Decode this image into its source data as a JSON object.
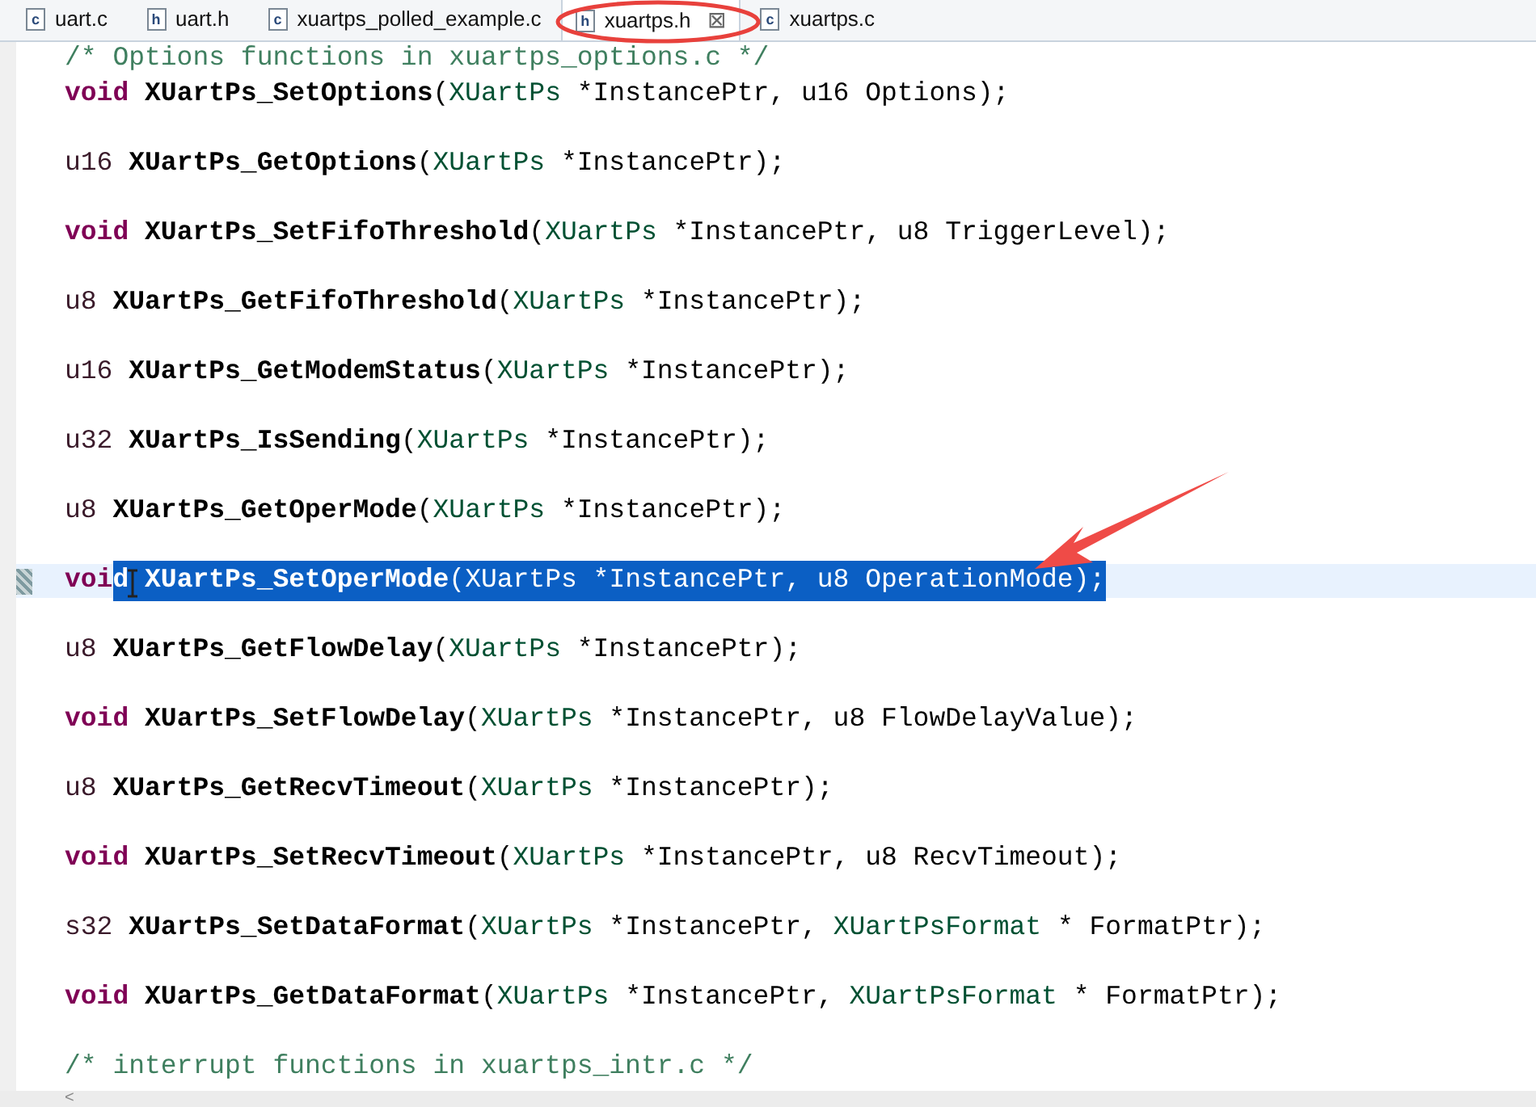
{
  "tabs": [
    {
      "icon": "c",
      "label": "uart.c",
      "selected": false,
      "closable": false
    },
    {
      "icon": "h",
      "label": "uart.h",
      "selected": false,
      "closable": false
    },
    {
      "icon": "c",
      "label": "xuartps_polled_example.c",
      "selected": false,
      "closable": false
    },
    {
      "icon": "h",
      "label": "xuartps.h",
      "selected": true,
      "closable": true
    },
    {
      "icon": "c",
      "label": "xuartps.c",
      "selected": false,
      "closable": false
    }
  ],
  "close_glyph": "⊠",
  "lines": [
    {
      "kind": "comment",
      "text": "/* Options functions in xuartps_options.c */"
    },
    {
      "kind": "code",
      "current": false,
      "tokens": [
        {
          "kind": "keyword",
          "text": "void"
        },
        {
          "kind": "func",
          "text": "XUartPs_SetOptions"
        },
        {
          "kind": "plain",
          "text": "("
        },
        {
          "kind": "typedef",
          "text": "XUartPs"
        },
        {
          "kind": "plain",
          "text": " *InstancePtr, u16 Options);"
        }
      ]
    },
    {
      "kind": "blank"
    },
    {
      "kind": "code",
      "current": false,
      "tokens": [
        {
          "kind": "type",
          "text": "u16"
        },
        {
          "kind": "func",
          "text": "XUartPs_GetOptions"
        },
        {
          "kind": "plain",
          "text": "("
        },
        {
          "kind": "typedef",
          "text": "XUartPs"
        },
        {
          "kind": "plain",
          "text": " *InstancePtr);"
        }
      ]
    },
    {
      "kind": "blank"
    },
    {
      "kind": "code",
      "current": false,
      "tokens": [
        {
          "kind": "keyword",
          "text": "void"
        },
        {
          "kind": "func",
          "text": "XUartPs_SetFifoThreshold"
        },
        {
          "kind": "plain",
          "text": "("
        },
        {
          "kind": "typedef",
          "text": "XUartPs"
        },
        {
          "kind": "plain",
          "text": " *InstancePtr, u8 TriggerLevel);"
        }
      ]
    },
    {
      "kind": "blank"
    },
    {
      "kind": "code",
      "current": false,
      "tokens": [
        {
          "kind": "type",
          "text": "u8"
        },
        {
          "kind": "func",
          "text": "XUartPs_GetFifoThreshold"
        },
        {
          "kind": "plain",
          "text": "("
        },
        {
          "kind": "typedef",
          "text": "XUartPs"
        },
        {
          "kind": "plain",
          "text": " *InstancePtr);"
        }
      ]
    },
    {
      "kind": "blank"
    },
    {
      "kind": "code",
      "current": false,
      "tokens": [
        {
          "kind": "type",
          "text": "u16"
        },
        {
          "kind": "func",
          "text": "XUartPs_GetModemStatus"
        },
        {
          "kind": "plain",
          "text": "("
        },
        {
          "kind": "typedef",
          "text": "XUartPs"
        },
        {
          "kind": "plain",
          "text": " *InstancePtr);"
        }
      ]
    },
    {
      "kind": "blank"
    },
    {
      "kind": "code",
      "current": false,
      "tokens": [
        {
          "kind": "type",
          "text": "u32"
        },
        {
          "kind": "func",
          "text": "XUartPs_IsSending"
        },
        {
          "kind": "plain",
          "text": "("
        },
        {
          "kind": "typedef",
          "text": "XUartPs"
        },
        {
          "kind": "plain",
          "text": " *InstancePtr);"
        }
      ]
    },
    {
      "kind": "blank"
    },
    {
      "kind": "code",
      "current": false,
      "tokens": [
        {
          "kind": "type",
          "text": "u8"
        },
        {
          "kind": "func",
          "text": "XUartPs_GetOperMode"
        },
        {
          "kind": "plain",
          "text": "("
        },
        {
          "kind": "typedef",
          "text": "XUartPs"
        },
        {
          "kind": "plain",
          "text": " *InstancePtr);"
        }
      ]
    },
    {
      "kind": "blank"
    },
    {
      "kind": "code",
      "current": true,
      "tokens": [
        {
          "kind": "keyword",
          "text": "voi",
          "selected": false
        },
        {
          "kind": "keyword",
          "text": "d",
          "selected": true
        },
        {
          "kind": "func",
          "text": " XUartPs_SetOperMode",
          "selected": true
        },
        {
          "kind": "plain",
          "text": "(XUartPs *InstancePtr, u8 OperationMode);",
          "selected": true
        }
      ]
    },
    {
      "kind": "blank"
    },
    {
      "kind": "code",
      "current": false,
      "tokens": [
        {
          "kind": "type",
          "text": "u8"
        },
        {
          "kind": "func",
          "text": "XUartPs_GetFlowDelay"
        },
        {
          "kind": "plain",
          "text": "("
        },
        {
          "kind": "typedef",
          "text": "XUartPs"
        },
        {
          "kind": "plain",
          "text": " *InstancePtr);"
        }
      ]
    },
    {
      "kind": "blank"
    },
    {
      "kind": "code",
      "current": false,
      "tokens": [
        {
          "kind": "keyword",
          "text": "void"
        },
        {
          "kind": "func",
          "text": "XUartPs_SetFlowDelay"
        },
        {
          "kind": "plain",
          "text": "("
        },
        {
          "kind": "typedef",
          "text": "XUartPs"
        },
        {
          "kind": "plain",
          "text": " *InstancePtr, u8 FlowDelayValue);"
        }
      ]
    },
    {
      "kind": "blank"
    },
    {
      "kind": "code",
      "current": false,
      "tokens": [
        {
          "kind": "type",
          "text": "u8"
        },
        {
          "kind": "func",
          "text": "XUartPs_GetRecvTimeout"
        },
        {
          "kind": "plain",
          "text": "("
        },
        {
          "kind": "typedef",
          "text": "XUartPs"
        },
        {
          "kind": "plain",
          "text": " *InstancePtr);"
        }
      ]
    },
    {
      "kind": "blank"
    },
    {
      "kind": "code",
      "current": false,
      "tokens": [
        {
          "kind": "keyword",
          "text": "void"
        },
        {
          "kind": "func",
          "text": "XUartPs_SetRecvTimeout"
        },
        {
          "kind": "plain",
          "text": "("
        },
        {
          "kind": "typedef",
          "text": "XUartPs"
        },
        {
          "kind": "plain",
          "text": " *InstancePtr, u8 RecvTimeout);"
        }
      ]
    },
    {
      "kind": "blank"
    },
    {
      "kind": "code",
      "current": false,
      "tokens": [
        {
          "kind": "type",
          "text": "s32"
        },
        {
          "kind": "func",
          "text": "XUartPs_SetDataFormat"
        },
        {
          "kind": "plain",
          "text": "("
        },
        {
          "kind": "typedef",
          "text": "XUartPs"
        },
        {
          "kind": "plain",
          "text": " *InstancePtr, "
        },
        {
          "kind": "typedef",
          "text": "XUartPsFormat"
        },
        {
          "kind": "plain",
          "text": " * FormatPtr);"
        }
      ]
    },
    {
      "kind": "blank"
    },
    {
      "kind": "code",
      "current": false,
      "tokens": [
        {
          "kind": "keyword",
          "text": "void"
        },
        {
          "kind": "func",
          "text": "XUartPs_GetDataFormat"
        },
        {
          "kind": "plain",
          "text": "("
        },
        {
          "kind": "typedef",
          "text": "XUartPs"
        },
        {
          "kind": "plain",
          "text": " *InstancePtr, "
        },
        {
          "kind": "typedef",
          "text": "XUartPsFormat"
        },
        {
          "kind": "plain",
          "text": " * FormatPtr);"
        }
      ]
    },
    {
      "kind": "blank"
    },
    {
      "kind": "comment",
      "text": "/* interrupt functions in xuartps_intr.c */"
    }
  ],
  "scrollbar": {
    "left_glyph": "<"
  }
}
